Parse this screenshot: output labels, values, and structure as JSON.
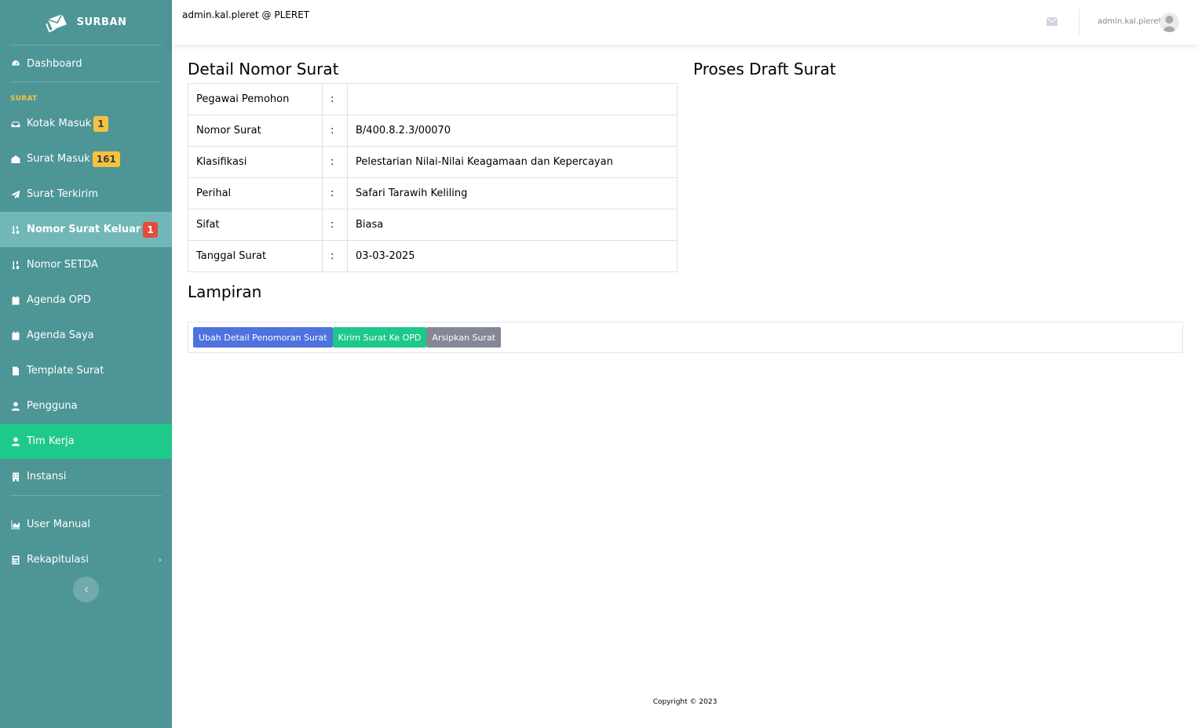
{
  "brand": {
    "name": "SURBAN"
  },
  "sidebar": {
    "dashboard": "Dashboard",
    "heading_surat": "SURAT",
    "items": [
      {
        "label": "Kotak Masuk",
        "badge": "1",
        "icon": "inbox-icon"
      },
      {
        "label": "Surat Masuk",
        "badge": "161",
        "icon": "envelope-open-icon"
      },
      {
        "label": "Surat Terkirim",
        "icon": "paper-plane-icon"
      },
      {
        "label": "Nomor Surat Keluar",
        "badge": "1",
        "icon": "sort-numeric-icon"
      },
      {
        "label": "Nomor SETDA",
        "icon": "sort-numeric-icon"
      },
      {
        "label": "Agenda OPD",
        "icon": "calendar-icon"
      },
      {
        "label": "Agenda Saya",
        "icon": "calendar-icon"
      },
      {
        "label": "Template Surat",
        "icon": "file-icon"
      },
      {
        "label": "Pengguna",
        "icon": "user-icon"
      },
      {
        "label": "Tim Kerja",
        "icon": "user-icon"
      },
      {
        "label": "Instansi",
        "icon": "building-icon"
      }
    ],
    "bottom_items": [
      {
        "label": "User Manual",
        "icon": "chart-area-icon"
      },
      {
        "label": "Rekapitulasi",
        "icon": "calculator-icon"
      }
    ]
  },
  "topbar": {
    "title": "admin.kal.pleret @ PLERET",
    "user_name": "admin.kal.pleret"
  },
  "main": {
    "detail_title": "Detail Nomor Surat",
    "proses_title": "Proses Draft Surat",
    "lampiran_title": "Lampiran",
    "colon": ":",
    "rows": [
      {
        "label": "Pegawai Pemohon",
        "value": ""
      },
      {
        "label": "Nomor Surat",
        "value": "B/400.8.2.3/00070"
      },
      {
        "label": "Klasifikasi",
        "value": "Pelestarian Nilai-Nilai Keagamaan dan Kepercayan"
      },
      {
        "label": "Perihal",
        "value": "Safari Tarawih Keliling"
      },
      {
        "label": "Sifat",
        "value": "Biasa"
      },
      {
        "label": "Tanggal Surat",
        "value": "03-03-2025"
      }
    ],
    "buttons": {
      "edit": "Ubah Detail Penomoran Surat",
      "send": "Kirim Surat Ke OPD",
      "archive": "Arsipkan Surat"
    }
  },
  "footer": {
    "copyright": "Copyright © 2023"
  },
  "colors": {
    "sidebar_bg": "#4e9596",
    "sidebar_active": "#71b7b8",
    "sidebar_active_green": "#1fc98a",
    "badge_yellow": "#f6c23e",
    "badge_red": "#e74a3b",
    "btn_primary": "#4e73df",
    "btn_success": "#1cc88a",
    "btn_secondary": "#858796"
  }
}
